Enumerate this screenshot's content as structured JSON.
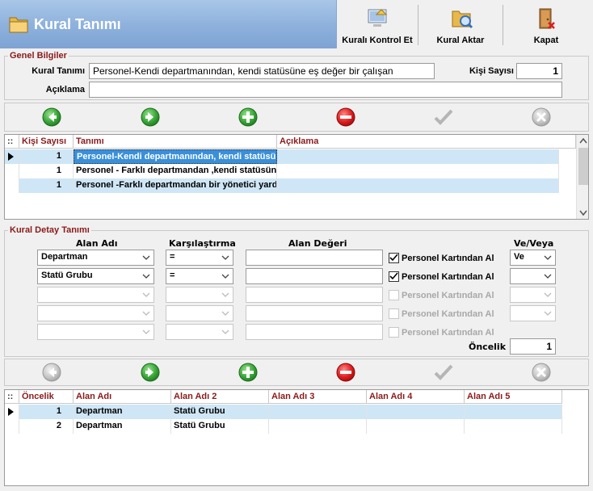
{
  "window": {
    "title": "Kural Tanımı"
  },
  "toolbar": {
    "check_rule": "Kuralı Kontrol Et",
    "export_rule": "Kural Aktar",
    "close": "Kapat"
  },
  "general": {
    "group_title": "Genel Bilgiler",
    "rule_label": "Kural Tanımı",
    "rule_value": "Personel-Kendi departmanından, kendi statüsüne eş değer bir çalışan",
    "count_label": "Kişi Sayısı",
    "count_value": "1",
    "description_label": "Açıklama",
    "description_value": ""
  },
  "rules_grid": {
    "headers": [
      "Kişi Sayısı",
      "Tanımı",
      "Açıklama"
    ],
    "rows": [
      {
        "count": "1",
        "definition": "Personel-Kendi departmanından, kendi statüsüne eş değer bir çalışan",
        "description": ""
      },
      {
        "count": "1",
        "definition": "Personel - Farklı departmandan ,kendi statüsüne eş değer bir çalışan",
        "description": ""
      },
      {
        "count": "1",
        "definition": "Personel -Farklı departmandan bir yönetici yardımcısı",
        "description": ""
      }
    ]
  },
  "detail": {
    "group_title": "Kural Detay Tanımı",
    "col_field": "Alan Adı",
    "col_compare": "Karşılaştırma",
    "col_value": "Alan Değeri",
    "col_andor": "Ve/Veya",
    "card_label": "Personel Kartından Al",
    "priority_label": "Öncelik",
    "priority_value": "1",
    "rows": [
      {
        "field": "Departman",
        "compare": "=",
        "value": "",
        "from_card": true,
        "andor": "Ve"
      },
      {
        "field": "Statü Grubu",
        "compare": "=",
        "value": "",
        "from_card": true,
        "andor": ""
      },
      {
        "field": "",
        "compare": "",
        "value": "",
        "from_card": false,
        "andor": ""
      },
      {
        "field": "",
        "compare": "",
        "value": "",
        "from_card": false,
        "andor": ""
      },
      {
        "field": "",
        "compare": "",
        "value": "",
        "from_card": false,
        "andor": ""
      }
    ]
  },
  "detail_grid": {
    "headers": [
      "Öncelik",
      "Alan Adı",
      "Alan Adı 2",
      "Alan Adı 3",
      "Alan Adı 4",
      "Alan Adı 5"
    ],
    "rows": [
      {
        "priority": "1",
        "f1": "Departman",
        "f2": "Statü Grubu",
        "f3": "",
        "f4": "",
        "f5": ""
      },
      {
        "priority": "2",
        "f1": "Departman",
        "f2": "Statü Grubu",
        "f3": "",
        "f4": "",
        "f5": ""
      }
    ]
  },
  "icons": {
    "back": "arrow-left-icon",
    "forward": "arrow-right-icon",
    "add": "plus-icon",
    "remove": "minus-icon",
    "confirm": "check-icon",
    "cancel": "x-icon"
  },
  "colors": {
    "header_gradient_top": "#a9c6e8",
    "header_gradient_bottom": "#7ea3d3",
    "label_maroon": "#8b1a1a",
    "selection_row": "#cfe6f6",
    "selection_cell": "#3a8fd9",
    "green_arrow": "#2e9b2e",
    "red_minus": "#d91e1e"
  }
}
